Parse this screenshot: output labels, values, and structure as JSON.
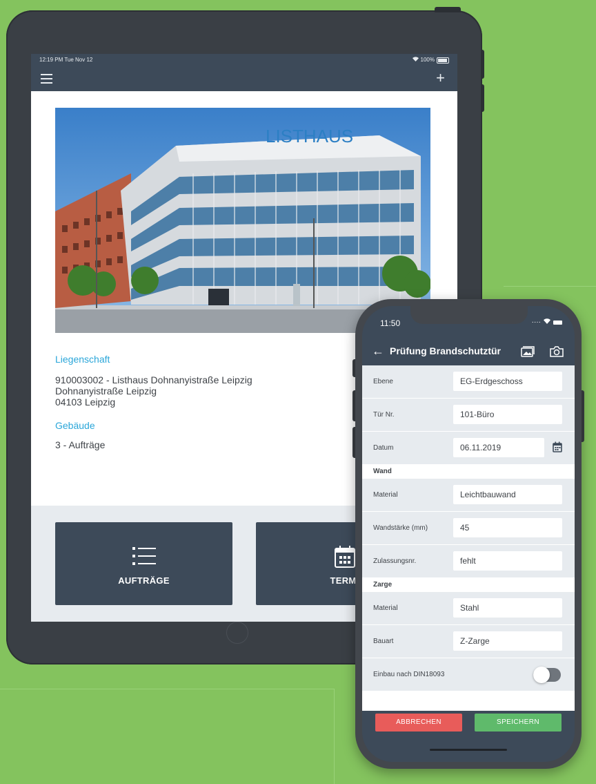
{
  "tablet": {
    "status_time": "12:19 PM  Tue Nov 12",
    "battery": "100%",
    "photo_sign_text": "LISTHAUS",
    "property": {
      "label": "Liegenschaft",
      "line1": "910003002 - Listhaus Dohnanyistraße Leipzig",
      "line2": "Dohnanyistraße Leipzig",
      "line3": "04103 Leipzig"
    },
    "building": {
      "label": "Gebäude",
      "value": "3 - Aufträge"
    },
    "tiles": [
      {
        "label": "AUFTRÄGE",
        "icon": "list-icon"
      },
      {
        "label": "TERMI",
        "icon": "calendar-icon"
      }
    ]
  },
  "phone": {
    "status_time": "11:50",
    "title": "Prüfung Brandschutztür",
    "rows": {
      "ebene": {
        "label": "Ebene",
        "value": "EG-Erdgeschoss"
      },
      "tuer": {
        "label": "Tür Nr.",
        "value": "101-Büro"
      },
      "datum": {
        "label": "Datum",
        "value": "06.11.2019"
      },
      "wand_material": {
        "label": "Material",
        "value": "Leichtbauwand"
      },
      "wandstaerke": {
        "label": "Wandstärke (mm)",
        "value": "45"
      },
      "zulassung": {
        "label": "Zulassungsnr.",
        "value": "fehlt"
      },
      "zarge_material": {
        "label": "Material",
        "value": "Stahl"
      },
      "bauart": {
        "label": "Bauart",
        "value": "Z-Zarge"
      },
      "einbau": {
        "label": "Einbau nach DIN18093",
        "on": false
      }
    },
    "sections": {
      "wand": "Wand",
      "zarge": "Zarge"
    },
    "buttons": {
      "cancel": "ABBRECHEN",
      "save": "SPEICHERN"
    }
  },
  "colors": {
    "background": "#84c35e",
    "nav": "#3d4a59",
    "accent_blue": "#2aa6d9",
    "cancel": "#e85c5a",
    "save": "#5fba6b"
  }
}
